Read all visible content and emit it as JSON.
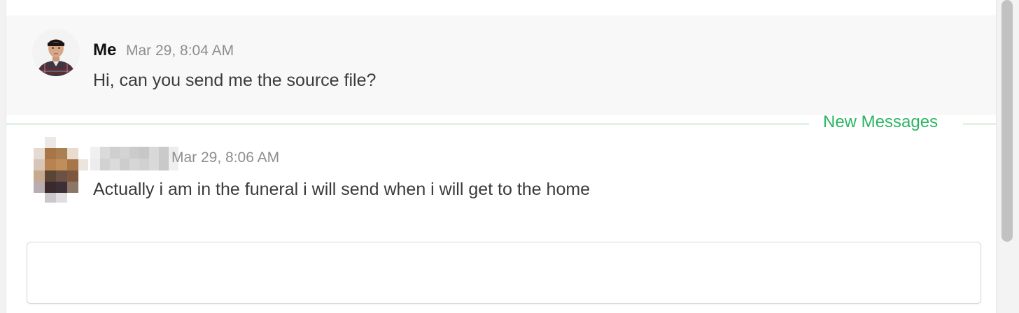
{
  "messages": [
    {
      "sender": "Me",
      "timestamp": "Mar 29, 8:04 AM",
      "text": "Hi, can you send me the source file?",
      "avatar": "user-photo-icon"
    },
    {
      "sender": "",
      "timestamp": "Mar 29, 8:06 AM",
      "text": "Actually i am in the funeral i will send when i will get to the home",
      "avatar": "pixelated-avatar-icon"
    }
  ],
  "divider": {
    "label": "New Messages"
  },
  "composer": {
    "value": "",
    "placeholder": ""
  },
  "colors": {
    "accent_green": "#2cb463",
    "divider_line": "#8fd5a2",
    "highlight_bg": "#f8f8f8",
    "timestamp_gray": "#8e8e8e"
  }
}
